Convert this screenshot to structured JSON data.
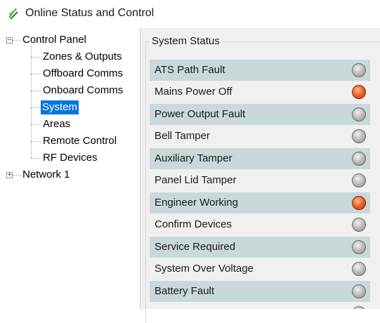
{
  "window": {
    "title": "Online Status and Control",
    "icon": "leaf-icon",
    "icon_color": "#4caf50"
  },
  "tree": {
    "root": {
      "label": "Control Panel",
      "expanded": true,
      "children": [
        {
          "label": "Zones & Outputs"
        },
        {
          "label": "Offboard Comms"
        },
        {
          "label": "Onboard Comms"
        },
        {
          "label": "System",
          "selected": true
        },
        {
          "label": "Areas"
        },
        {
          "label": "Remote Control"
        },
        {
          "label": "RF Devices"
        }
      ]
    },
    "network": {
      "label": "Network 1",
      "expanded": false
    }
  },
  "system_status": {
    "group_title": "System Status",
    "colors": {
      "row_shaded": "#c9d9da",
      "led_on": "#f2632a",
      "led_off": "#b0b0b0",
      "selection": "#0078d7"
    },
    "items": [
      {
        "label": "ATS Path Fault",
        "active": false
      },
      {
        "label": "Mains Power Off",
        "active": true
      },
      {
        "label": "Power Output Fault",
        "active": false
      },
      {
        "label": "Bell Tamper",
        "active": false
      },
      {
        "label": "Auxiliary Tamper",
        "active": false
      },
      {
        "label": "Panel Lid Tamper",
        "active": false
      },
      {
        "label": "Engineer Working",
        "active": true
      },
      {
        "label": "Confirm Devices",
        "active": false
      },
      {
        "label": "Service Required",
        "active": false
      },
      {
        "label": "System Over Voltage",
        "active": false
      },
      {
        "label": "Battery Fault",
        "active": false
      }
    ]
  }
}
